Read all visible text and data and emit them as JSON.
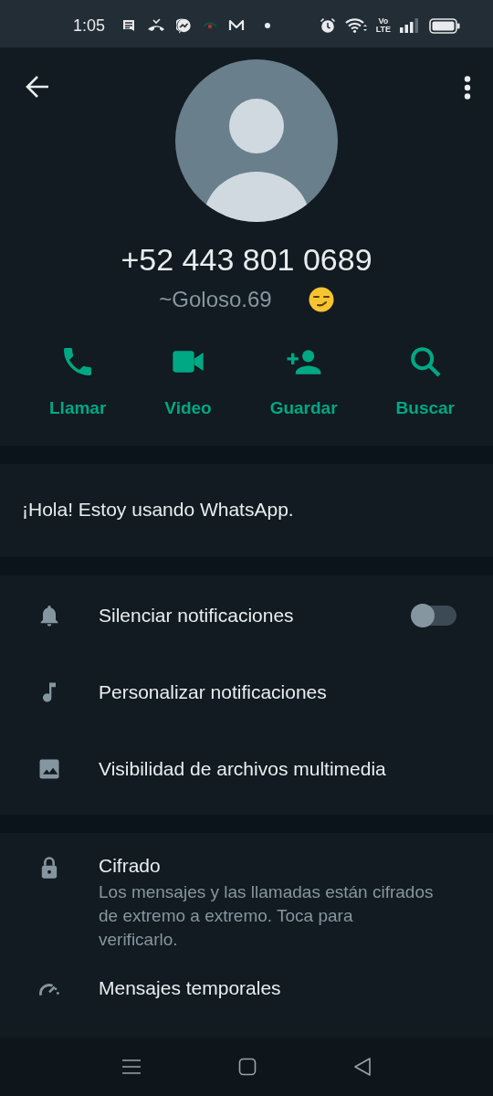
{
  "status_bar": {
    "time": "1:05",
    "volte_top": "Vo",
    "volte_bottom": "LTE"
  },
  "contact": {
    "phone": "+52 443 801 0689",
    "name": "~Goloso.69"
  },
  "actions": [
    {
      "kind": "call",
      "label": "Llamar"
    },
    {
      "kind": "video",
      "label": "Video"
    },
    {
      "kind": "add",
      "label": "Guardar"
    },
    {
      "kind": "search",
      "label": "Buscar"
    }
  ],
  "about": "¡Hola! Estoy usando WhatsApp.",
  "settings": [
    {
      "kind": "bell",
      "label": "Silenciar notificaciones",
      "on": false
    },
    {
      "kind": "note",
      "label": "Personalizar notificaciones"
    },
    {
      "kind": "image",
      "label": "Visibilidad de archivos multimedia"
    }
  ],
  "security": [
    {
      "kind": "lock",
      "label": "Cifrado",
      "description": "Los mensajes y las llamadas están cifrados de extremo a extremo. Toca para verificarlo."
    },
    {
      "kind": "timer",
      "label": "Mensajes temporales"
    }
  ]
}
